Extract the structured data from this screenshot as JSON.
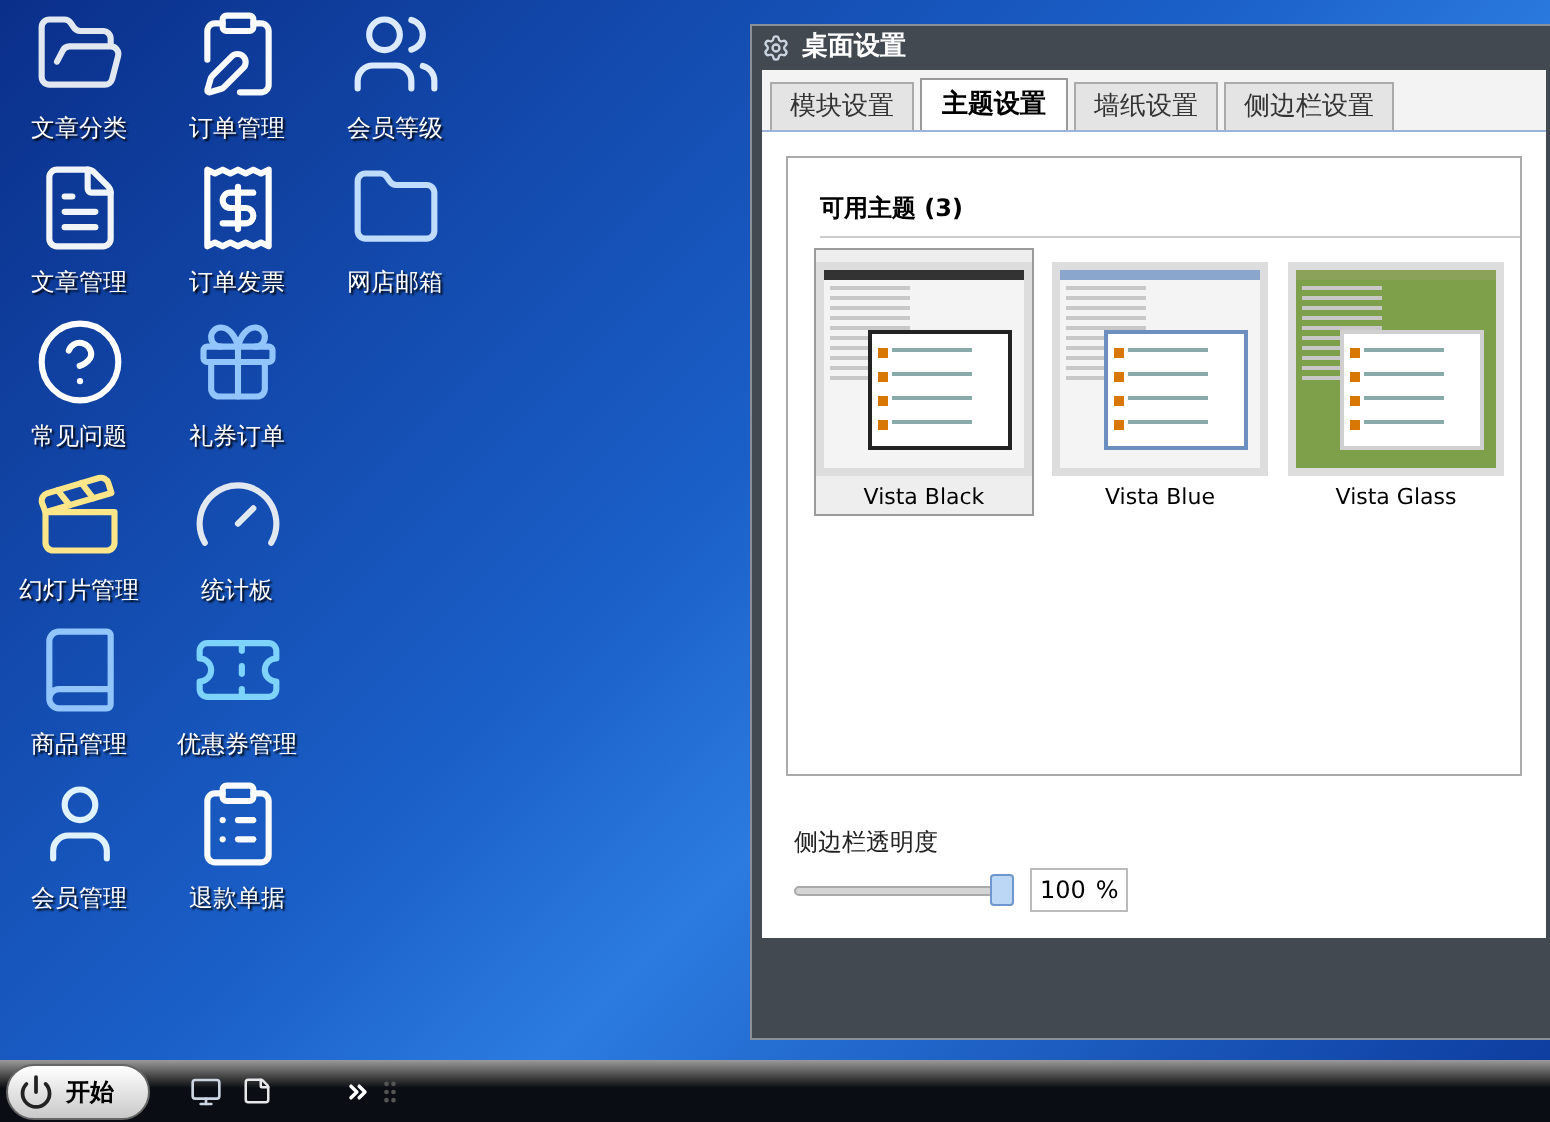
{
  "desktop_icons": [
    [
      {
        "label": "文章分类"
      },
      {
        "label": "订单管理"
      },
      {
        "label": "会员等级"
      }
    ],
    [
      {
        "label": "文章管理"
      },
      {
        "label": "订单发票"
      },
      {
        "label": "网店邮箱"
      }
    ],
    [
      {
        "label": "常见问题"
      },
      {
        "label": "礼券订单"
      }
    ],
    [
      {
        "label": "幻灯片管理"
      },
      {
        "label": "统计板"
      }
    ],
    [
      {
        "label": "商品管理"
      },
      {
        "label": "优惠券管理"
      }
    ],
    [
      {
        "label": "会员管理"
      },
      {
        "label": "退款单据"
      }
    ]
  ],
  "window": {
    "title": "桌面设置",
    "tabs": [
      {
        "label": "模块设置",
        "selected": false
      },
      {
        "label": "主题设置",
        "selected": true
      },
      {
        "label": "墙纸设置",
        "selected": false
      },
      {
        "label": "侧边栏设置",
        "selected": false
      }
    ],
    "themes_heading": "可用主题 (3)",
    "themes": [
      {
        "name": "Vista Black",
        "selected": true
      },
      {
        "name": "Vista Blue",
        "selected": false
      },
      {
        "name": "Vista Glass",
        "selected": false
      }
    ],
    "opacity": {
      "label": "侧边栏透明度",
      "level": 1,
      "value": "100",
      "unit": "%"
    }
  },
  "taskbar": {
    "start_label": "开始"
  }
}
